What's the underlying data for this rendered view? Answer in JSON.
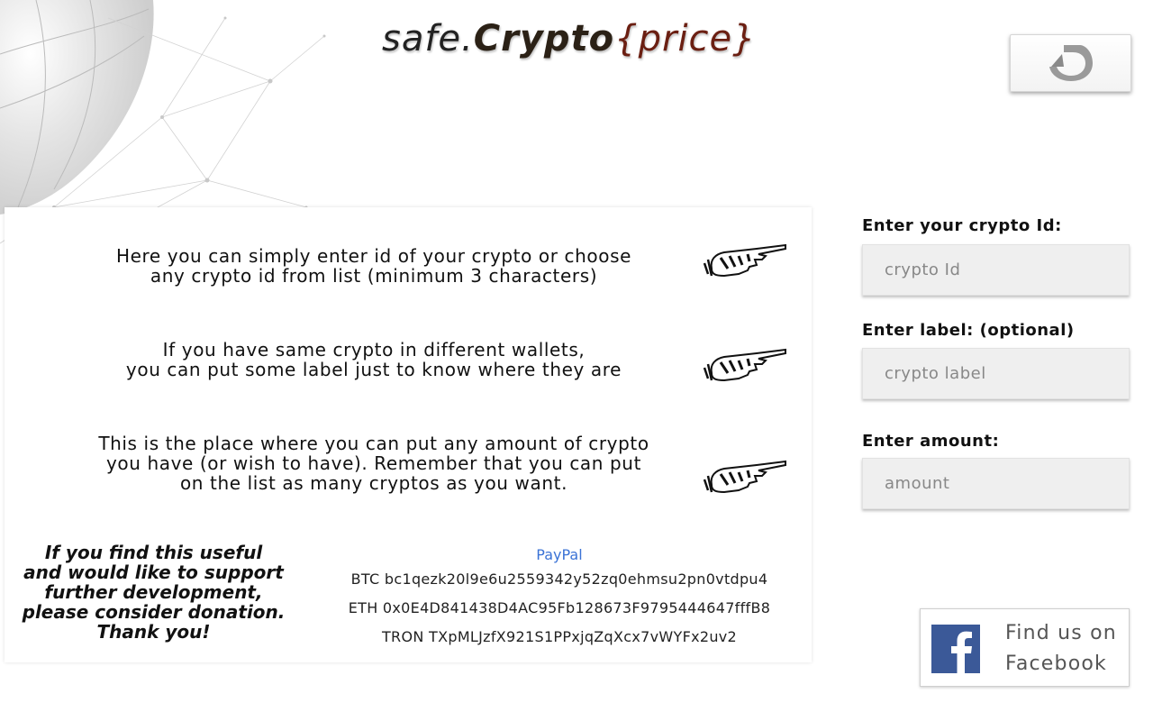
{
  "header": {
    "logo_part1": "safe.",
    "logo_part2": "Crypto",
    "logo_part3": "{price}",
    "back_icon": "undo-arrow-icon"
  },
  "tips": [
    {
      "lines": [
        "Here you can simply enter id of your crypto or choose",
        "any crypto id from list (minimum 3 characters)"
      ],
      "icon": "pointing-hand-icon"
    },
    {
      "lines": [
        "If you have same crypto in different wallets,",
        "you can put some label just to know where they are"
      ],
      "icon": "pointing-hand-icon"
    },
    {
      "lines": [
        "This is the place where you can put any amount of crypto",
        "you have (or wish to have). Remember that you can put",
        "on the list as many cryptos as you want."
      ],
      "icon": "pointing-hand-icon"
    }
  ],
  "donation": {
    "lines": [
      "If you find this useful",
      "and would like to support",
      "further development,",
      "please consider donation.",
      "Thank you!"
    ],
    "paypal": "PayPal",
    "btc": "BTC bc1qezk20l9e6u2559342y52zq0ehmsu2pn0vtdpu4",
    "eth": "ETH 0x0E4D841438D4AC95Fb128673F9795444647fffB8",
    "tron": "TRON TXpMLJzfX921S1PPxjqZqXcx7vWYFx2uv2"
  },
  "form": {
    "id_label": "Enter your crypto Id:",
    "id_placeholder": "crypto Id",
    "id_value": "",
    "label_label": "Enter label: (optional)",
    "label_placeholder": "crypto label",
    "label_value": "",
    "amount_label": "Enter amount:",
    "amount_placeholder": "amount",
    "amount_value": ""
  },
  "facebook": {
    "line1": "Find us on",
    "line2": "Facebook",
    "icon": "facebook-icon"
  },
  "colors": {
    "logo_dark": "#222222",
    "logo_brace": "#6b1f12",
    "paypal": "#3b73d6",
    "facebook": "#3b5998",
    "input_bg": "#efefef"
  }
}
